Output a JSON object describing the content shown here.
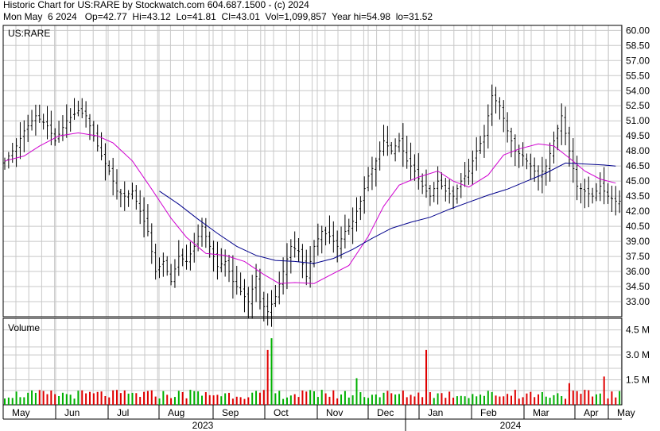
{
  "header": {
    "line1": "Historic Chart for US:RARE by Stockwatch.com 604.687.1500 - (c) 2024",
    "line2": "Mon May  6 2024   Op=42.77  Hi=43.12  Lo=41.81  Cl=43.01  Vol=1,099,857  Year hi=54.98  lo=31.52"
  },
  "colors": {
    "grid": "#c8c8c8",
    "price_bar": "#000000",
    "short_ma": "#d000d0",
    "long_ma": "#00008b",
    "volume_up": "#00b000",
    "volume_down": "#e00000"
  },
  "chart_data": [
    {
      "type": "ohlc",
      "title": "US:RARE",
      "y_tick_labels": [
        "60.00",
        "58.50",
        "57.00",
        "55.50",
        "54.00",
        "52.50",
        "51.00",
        "49.50",
        "48.00",
        "46.50",
        "45.00",
        "43.50",
        "42.00",
        "40.50",
        "39.00",
        "37.50",
        "36.00",
        "34.50",
        "33.00"
      ],
      "ylim": [
        31.5,
        60.5
      ],
      "x_tick_labels": [
        "May",
        "Jun",
        "Jul",
        "Aug",
        "Sep",
        "Oct",
        "Nov",
        "Dec",
        "Jan",
        "Feb",
        "Mar",
        "Apr",
        "May"
      ],
      "year_labels": [
        "2023",
        "2024"
      ],
      "grid": true,
      "close_path": [
        [
          0,
          47.0
        ],
        [
          3,
          48.5
        ],
        [
          5,
          50.0
        ],
        [
          8,
          51.5
        ],
        [
          11,
          50.5
        ],
        [
          13,
          49.0
        ],
        [
          16,
          51.0
        ],
        [
          19,
          52.0
        ],
        [
          21,
          51.5
        ],
        [
          23,
          49.5
        ],
        [
          25,
          47.5
        ],
        [
          27,
          46.0
        ],
        [
          29,
          44.0
        ],
        [
          31,
          43.5
        ],
        [
          33,
          44.0
        ],
        [
          35,
          42.0
        ],
        [
          37,
          40.0
        ],
        [
          39,
          36.0
        ],
        [
          41,
          37.0
        ],
        [
          43,
          35.0
        ],
        [
          45,
          37.5
        ],
        [
          47,
          37.0
        ],
        [
          49,
          38.5
        ],
        [
          51,
          40.5
        ],
        [
          53,
          38.5
        ],
        [
          55,
          36.5
        ],
        [
          57,
          37.0
        ],
        [
          59,
          35.0
        ],
        [
          61,
          34.0
        ],
        [
          63,
          33.0
        ],
        [
          65,
          35.5
        ],
        [
          66,
          33.0
        ],
        [
          67,
          32.5
        ],
        [
          68,
          32.0
        ],
        [
          70,
          33.5
        ],
        [
          72,
          36.0
        ],
        [
          74,
          38.5
        ],
        [
          76,
          38.0
        ],
        [
          78,
          35.5
        ],
        [
          80,
          38.5
        ],
        [
          82,
          40.0
        ],
        [
          84,
          39.5
        ],
        [
          86,
          38.5
        ],
        [
          88,
          40.0
        ],
        [
          90,
          41.0
        ],
        [
          92,
          43.0
        ],
        [
          94,
          45.5
        ],
        [
          96,
          47.0
        ],
        [
          98,
          49.0
        ],
        [
          100,
          48.0
        ],
        [
          102,
          49.0
        ],
        [
          104,
          47.0
        ],
        [
          106,
          46.0
        ],
        [
          108,
          44.5
        ],
        [
          110,
          43.5
        ],
        [
          112,
          45.0
        ],
        [
          114,
          44.0
        ],
        [
          116,
          43.5
        ],
        [
          118,
          45.0
        ],
        [
          120,
          46.0
        ],
        [
          122,
          48.0
        ],
        [
          124,
          49.5
        ],
        [
          126,
          53.5
        ],
        [
          128,
          52.5
        ],
        [
          130,
          50.0
        ],
        [
          132,
          48.0
        ],
        [
          134,
          47.5
        ],
        [
          136,
          46.5
        ],
        [
          138,
          45.5
        ],
        [
          140,
          46.5
        ],
        [
          142,
          49.0
        ],
        [
          144,
          51.5
        ],
        [
          146,
          48.0
        ],
        [
          148,
          44.5
        ],
        [
          150,
          44.0
        ],
        [
          152,
          43.5
        ],
        [
          154,
          44.5
        ],
        [
          156,
          43.5
        ],
        [
          158,
          43.0
        ]
      ],
      "series": [
        {
          "values": [
            [
              0,
              47.0
            ],
            [
              5,
              47.5
            ],
            [
              9,
              48.5
            ],
            [
              14,
              49.5
            ],
            [
              19,
              49.8
            ],
            [
              24,
              49.5
            ],
            [
              28,
              48.8
            ],
            [
              33,
              47.0
            ],
            [
              38,
              44.2
            ],
            [
              43,
              41.3
            ],
            [
              47,
              39.4
            ],
            [
              52,
              37.8
            ],
            [
              57,
              37.6
            ],
            [
              62,
              37.0
            ],
            [
              67,
              35.7
            ],
            [
              71,
              34.8
            ],
            [
              75,
              34.9
            ],
            [
              80,
              34.8
            ],
            [
              84,
              35.6
            ],
            [
              89,
              36.6
            ],
            [
              94,
              39.5
            ],
            [
              98,
              42.5
            ],
            [
              102,
              44.6
            ],
            [
              107,
              45.4
            ],
            [
              112,
              46.0
            ],
            [
              116,
              45.0
            ],
            [
              120,
              44.4
            ],
            [
              125,
              45.6
            ],
            [
              129,
              47.6
            ],
            [
              133,
              48.2
            ],
            [
              138,
              48.7
            ],
            [
              142,
              48.5
            ],
            [
              146,
              47.3
            ],
            [
              150,
              46.0
            ],
            [
              154,
              45.2
            ],
            [
              158,
              44.8
            ]
          ]
        },
        {
          "values": [
            [
              40,
              44.0
            ],
            [
              45,
              42.7
            ],
            [
              50,
              41.2
            ],
            [
              55,
              39.8
            ],
            [
              60,
              38.5
            ],
            [
              65,
              37.6
            ],
            [
              70,
              37.1
            ],
            [
              75,
              37.0
            ],
            [
              80,
              36.8
            ],
            [
              85,
              37.3
            ],
            [
              90,
              38.2
            ],
            [
              95,
              39.3
            ],
            [
              100,
              40.3
            ],
            [
              105,
              40.9
            ],
            [
              110,
              41.4
            ],
            [
              115,
              42.2
            ],
            [
              120,
              42.9
            ],
            [
              125,
              43.6
            ],
            [
              130,
              44.2
            ],
            [
              135,
              45.0
            ],
            [
              140,
              45.8
            ],
            [
              145,
              46.8
            ],
            [
              150,
              46.7
            ],
            [
              155,
              46.6
            ],
            [
              158,
              46.5
            ]
          ]
        }
      ]
    },
    {
      "type": "bar",
      "title": "Volume",
      "y_tick_labels": [
        "4.5 M",
        "3.0 M",
        "1.5 M"
      ],
      "ylim": [
        0,
        5.2
      ],
      "units": "M",
      "spikes": [
        [
          48,
          0.9
        ],
        [
          68,
          3.3
        ],
        [
          69,
          4.0
        ],
        [
          82,
          0.9
        ],
        [
          91,
          1.6
        ],
        [
          109,
          3.3
        ],
        [
          132,
          0.9
        ],
        [
          146,
          1.3
        ],
        [
          155,
          1.7
        ]
      ]
    }
  ]
}
